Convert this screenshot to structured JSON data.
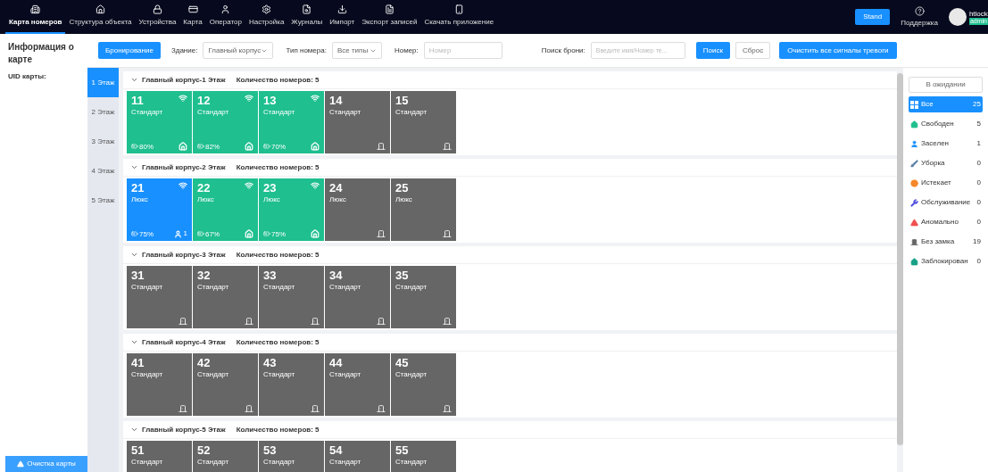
{
  "nav": {
    "items": [
      {
        "label": "Карта номеров",
        "selected": true
      },
      {
        "label": "Структура объекта",
        "selected": false
      },
      {
        "label": "Устройства",
        "selected": false
      },
      {
        "label": "Карта",
        "selected": false
      },
      {
        "label": "Оператор",
        "selected": false
      },
      {
        "label": "Настройка",
        "selected": false
      },
      {
        "label": "Журналы",
        "selected": false
      },
      {
        "label": "Импорт",
        "selected": false
      },
      {
        "label": "Экспорт записей",
        "selected": false
      },
      {
        "label": "Скачать приложение",
        "selected": false
      }
    ],
    "stand_button": "Stand",
    "support": "Поддержка",
    "user": {
      "name": "htlock",
      "role": "admin"
    }
  },
  "card_info": {
    "title": "Информация о карте",
    "uid_label": "UID карты:",
    "clear_button": "Очистка карты"
  },
  "toolbar": {
    "booking_button": "Бронирование",
    "building_label": "Здание:",
    "building_value": "Главный корпус",
    "type_label": "Тип номера:",
    "type_value": "Все типы",
    "number_label": "Номер:",
    "number_placeholder": "Номер",
    "search_label": "Поиск брони:",
    "search_placeholder": "Введите имя/Номер те...",
    "search_button": "Поиск",
    "reset_button": "Сброс",
    "clear_alarms_button": "Очистить все сигналы тревоги"
  },
  "floors": [
    {
      "label": "1 Этаж",
      "selected": true
    },
    {
      "label": "2 Этаж",
      "selected": false
    },
    {
      "label": "3 Этаж",
      "selected": false
    },
    {
      "label": "4 Этаж",
      "selected": false
    },
    {
      "label": "5 Этаж",
      "selected": false
    }
  ],
  "sections": [
    {
      "title": "Главный корпус-1 Этаж",
      "count": "Количество номеров: 5",
      "expanded": true,
      "rooms": [
        {
          "number": "11",
          "type": "Стандарт",
          "kind": "free",
          "battery": "80%"
        },
        {
          "number": "12",
          "type": "Стандарт",
          "kind": "free",
          "battery": "82%"
        },
        {
          "number": "13",
          "type": "Стандарт",
          "kind": "free",
          "battery": "70%"
        },
        {
          "number": "14",
          "type": "Стандарт",
          "kind": "nolock"
        },
        {
          "number": "15",
          "type": "Стандарт",
          "kind": "nolock"
        }
      ]
    },
    {
      "title": "Главный корпус-2 Этаж",
      "count": "Количество номеров: 5",
      "expanded": true,
      "rooms": [
        {
          "number": "21",
          "type": "Люкс",
          "kind": "occupied",
          "battery": "75%",
          "guests": "1"
        },
        {
          "number": "22",
          "type": "Люкс",
          "kind": "free",
          "battery": "67%"
        },
        {
          "number": "23",
          "type": "Люкс",
          "kind": "free",
          "battery": "75%"
        },
        {
          "number": "24",
          "type": "Люкс",
          "kind": "nolock"
        },
        {
          "number": "25",
          "type": "Люкс",
          "kind": "nolock"
        }
      ]
    },
    {
      "title": "Главный корпус-3 Этаж",
      "count": "Количество номеров: 5",
      "expanded": true,
      "rooms": [
        {
          "number": "31",
          "type": "Стандарт",
          "kind": "nolock"
        },
        {
          "number": "32",
          "type": "Стандарт",
          "kind": "nolock"
        },
        {
          "number": "33",
          "type": "Стандарт",
          "kind": "nolock"
        },
        {
          "number": "34",
          "type": "Стандарт",
          "kind": "nolock"
        },
        {
          "number": "35",
          "type": "Стандарт",
          "kind": "nolock"
        }
      ]
    },
    {
      "title": "Главный корпус-4 Этаж",
      "count": "Количество номеров: 5",
      "expanded": true,
      "rooms": [
        {
          "number": "41",
          "type": "Стандарт",
          "kind": "nolock"
        },
        {
          "number": "42",
          "type": "Стандарт",
          "kind": "nolock"
        },
        {
          "number": "43",
          "type": "Стандарт",
          "kind": "nolock"
        },
        {
          "number": "44",
          "type": "Стандарт",
          "kind": "nolock"
        },
        {
          "number": "45",
          "type": "Стандарт",
          "kind": "nolock"
        }
      ]
    },
    {
      "title": "Главный корпус-5 Этаж",
      "count": "Количество номеров: 5",
      "expanded": true,
      "rooms": [
        {
          "number": "51",
          "type": "Стандарт",
          "kind": "nolock"
        },
        {
          "number": "52",
          "type": "Стандарт",
          "kind": "nolock"
        },
        {
          "number": "53",
          "type": "Стандарт",
          "kind": "nolock"
        },
        {
          "number": "54",
          "type": "Стандарт",
          "kind": "nolock"
        },
        {
          "number": "55",
          "type": "Стандарт",
          "kind": "nolock"
        }
      ]
    }
  ],
  "filters": {
    "waiting_button": "В ожидании",
    "items": [
      {
        "label": "Все",
        "count": "25",
        "selected": true,
        "color": "#ffffff"
      },
      {
        "label": "Свободен",
        "count": "5",
        "selected": false,
        "color": "#1fbf8f"
      },
      {
        "label": "Заселен",
        "count": "1",
        "selected": false,
        "color": "#1890ff"
      },
      {
        "label": "Уборка",
        "count": "0",
        "selected": false,
        "color": "#5b7fa6"
      },
      {
        "label": "Истекает",
        "count": "0",
        "selected": false,
        "color": "#f5882a"
      },
      {
        "label": "Обслуживание",
        "count": "0",
        "selected": false,
        "color": "#5050e0"
      },
      {
        "label": "Аномально",
        "count": "0",
        "selected": false,
        "color": "#f05050"
      },
      {
        "label": "Без замка",
        "count": "19",
        "selected": false,
        "color": "#666666"
      },
      {
        "label": "Заблокирован",
        "count": "0",
        "selected": false,
        "color": "#16a085"
      }
    ]
  }
}
